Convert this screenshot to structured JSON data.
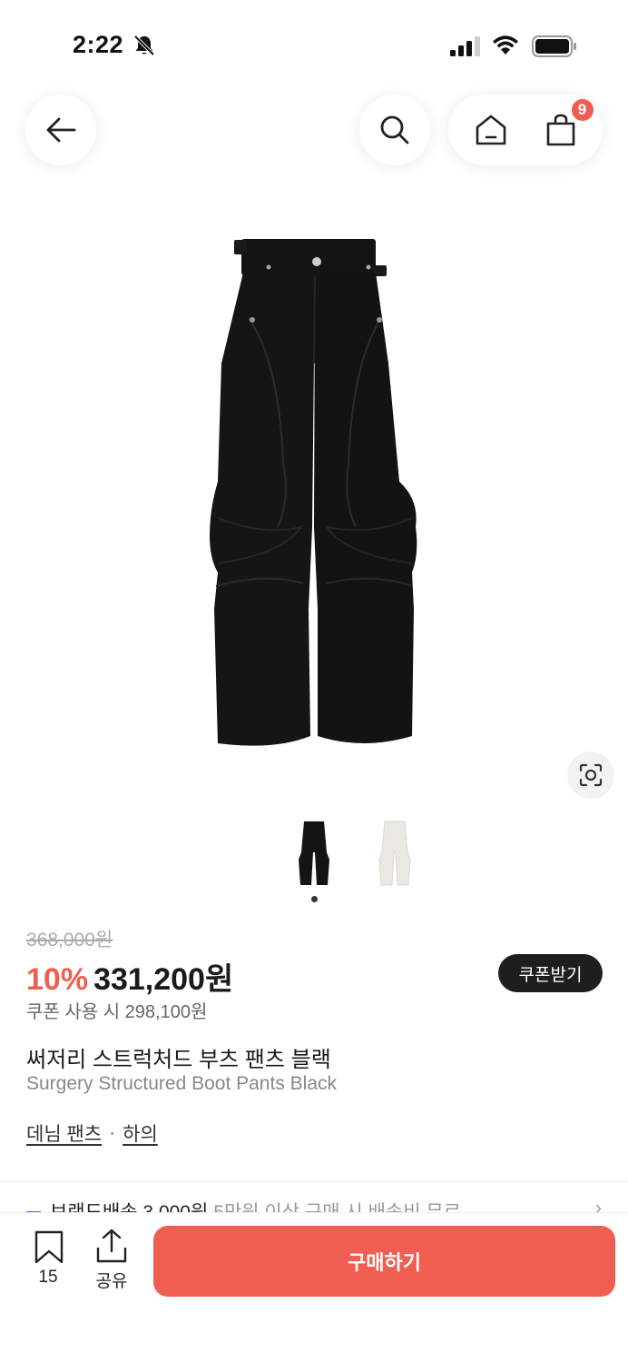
{
  "status": {
    "time": "2:22",
    "icons": [
      "bell-slash-icon",
      "cellular-signal-icon",
      "wifi-icon",
      "battery-icon"
    ]
  },
  "nav": {
    "icons": [
      "back-arrow-icon",
      "search-icon",
      "home-icon",
      "shopping-bag-icon"
    ],
    "cart_badge": "9"
  },
  "product": {
    "image_icon": "product-photo",
    "thumbnail_icons": [
      "thumbnail-black-pants",
      "thumbnail-white-pants"
    ],
    "active_thumbnail": 1,
    "original_price": "368,000원",
    "discount": "10%",
    "price": "331,200원",
    "coupon_price": "쿠폰 사용 시 298,100원",
    "coupon_button": "쿠폰받기",
    "name_ko": "써저리 스트럭처드 부츠 팬츠 블랙",
    "name_en": "Surgery Structured Boot Pants Black",
    "category_1": "데님 팬츠",
    "category_sep": "·",
    "category_2": "하의"
  },
  "shipping": {
    "label": "브랜드배송 3,000원",
    "sub": "5만원 이상 구매 시 배송비 무료",
    "chevron": "›"
  },
  "bottom": {
    "bookmark_count": "15",
    "share_label": "공유",
    "buy_label": "구매하기"
  },
  "colors": {
    "accent": "#ef5e50",
    "dark_button": "#1e1e1e"
  }
}
